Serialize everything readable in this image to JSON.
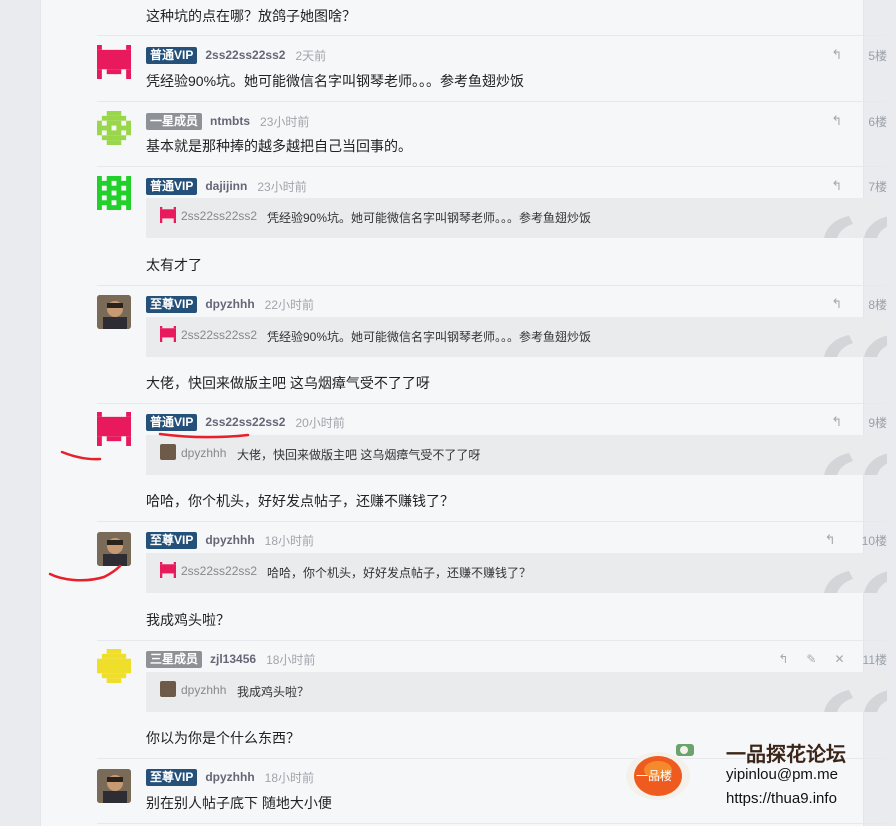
{
  "prev_post": {
    "text": "这种坑的点在哪？放鸽子她图啥？"
  },
  "posts": [
    {
      "badge": "普通VIP",
      "user": "2ss22ss22ss2",
      "time": "2天前",
      "floor": "5楼",
      "text": "凭经验90%坑。她可能微信名字叫钢琴老师。。。参考鱼翅炒饭"
    },
    {
      "badge": "一星成员",
      "user": "ntmbts",
      "time": "23小时前",
      "floor": "6楼",
      "text": "基本就是那种捧的越多越把自己当回事的。"
    },
    {
      "badge": "普通VIP",
      "user": "dajijinn",
      "time": "23小时前",
      "floor": "7楼",
      "quote": {
        "user": "2ss22ss22ss2",
        "text": "凭经验90%坑。她可能微信名字叫钢琴老师。。。参考鱼翅炒饭"
      },
      "text": "太有才了"
    },
    {
      "badge": "至尊VIP",
      "user": "dpyzhhh",
      "time": "22小时前",
      "floor": "8楼",
      "quote": {
        "user": "2ss22ss22ss2",
        "text": "凭经验90%坑。她可能微信名字叫钢琴老师。。。参考鱼翅炒饭"
      },
      "text": "大佬，快回来做版主吧 这乌烟瘴气受不了了呀"
    },
    {
      "badge": "普通VIP",
      "user": "2ss22ss22ss2",
      "time": "20小时前",
      "floor": "9楼",
      "quote": {
        "user": "dpyzhhh",
        "text": "大佬，快回来做版主吧 这乌烟瘴气受不了了呀"
      },
      "text": "哈哈，你个机头，好好发点帖子，还赚不赚钱了？"
    },
    {
      "badge": "至尊VIP",
      "user": "dpyzhhh",
      "time": "18小时前",
      "floor": "10楼",
      "quote": {
        "user": "2ss22ss22ss2",
        "text": "哈哈，你个机头，好好发点帖子，还赚不赚钱了？"
      },
      "text": "我成鸡头啦？"
    },
    {
      "badge": "三星成员",
      "user": "zjl13456",
      "time": "18小时前",
      "floor": "11楼",
      "quote": {
        "user": "dpyzhhh",
        "text": "我成鸡头啦？"
      },
      "text": "你以为你是个什么东西？"
    },
    {
      "badge": "至尊VIP",
      "user": "dpyzhhh",
      "time": "18小时前",
      "floor": "",
      "text": "别在别人帖子底下 随地大小便"
    }
  ],
  "watermark": {
    "title": "一品探花论坛",
    "line1": "yipinlou@pm.me",
    "line2": "https://thua9.info",
    "logo_text": "一品楼"
  },
  "icons": {
    "reply": "reply-icon",
    "edit": "edit-icon",
    "delete": "delete-icon"
  },
  "colors": {
    "vip_badge": "#24507a",
    "member_badge": "#8e9296",
    "annotation_red": "#e8202a"
  }
}
